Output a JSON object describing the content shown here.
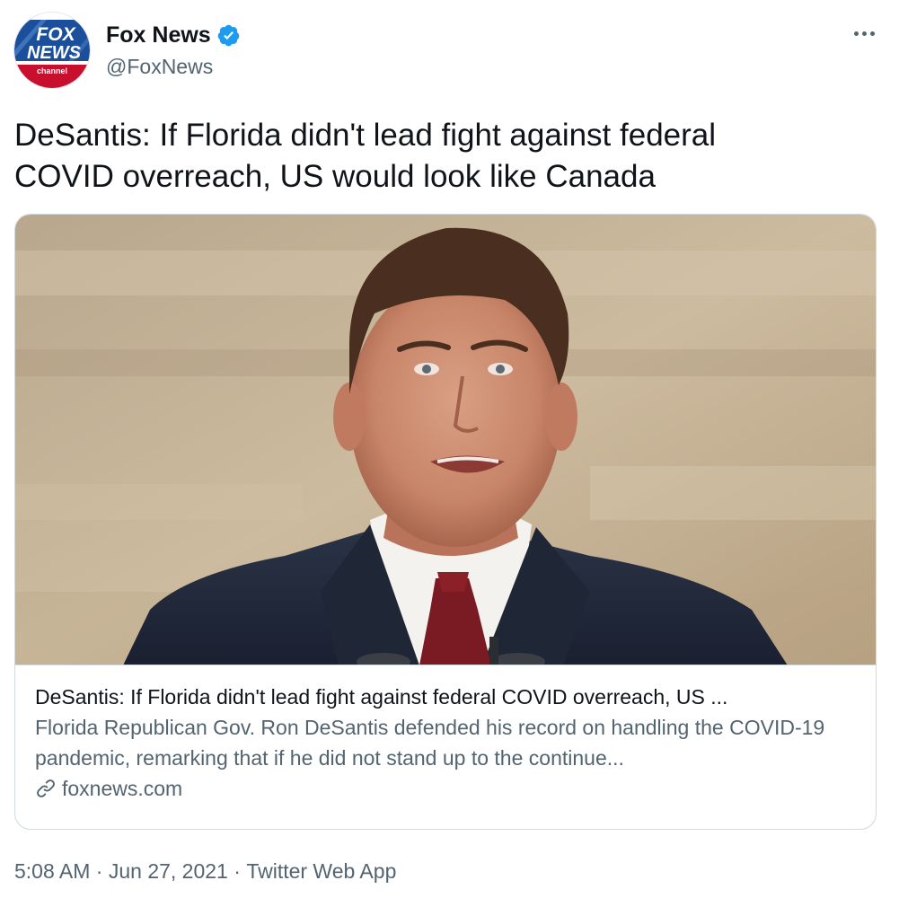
{
  "author": {
    "name": "Fox News",
    "handle": "@FoxNews",
    "verified_icon": "verified-badge-icon",
    "avatar_logo": {
      "line1": "FOX",
      "line2": "NEWS",
      "line3": "channel"
    }
  },
  "tweet": {
    "text": "DeSantis: If Florida didn't lead fight against federal\nCOVID overreach, US would look like Canada"
  },
  "card": {
    "image_alt": "Florida Gov. Ron DeSantis speaking at a podium",
    "title": "DeSantis: If Florida didn't lead fight against federal COVID overreach, US ...",
    "description": "Florida Republican Gov. Ron DeSantis defended his record on handling the COVID-19 pandemic, remarking that if he did not stand up to the continue...",
    "domain": "foxnews.com",
    "link_icon": "link-icon"
  },
  "meta": {
    "time": "5:08 AM",
    "separator": " · ",
    "date": "Jun 27, 2021",
    "source": "Twitter Web App"
  },
  "colors": {
    "text_primary": "#0f1419",
    "text_secondary": "#536471",
    "verified": "#1d9bf0",
    "border": "#cfd9de",
    "fox_blue": "#1b4f9c",
    "fox_red": "#c8102e"
  }
}
